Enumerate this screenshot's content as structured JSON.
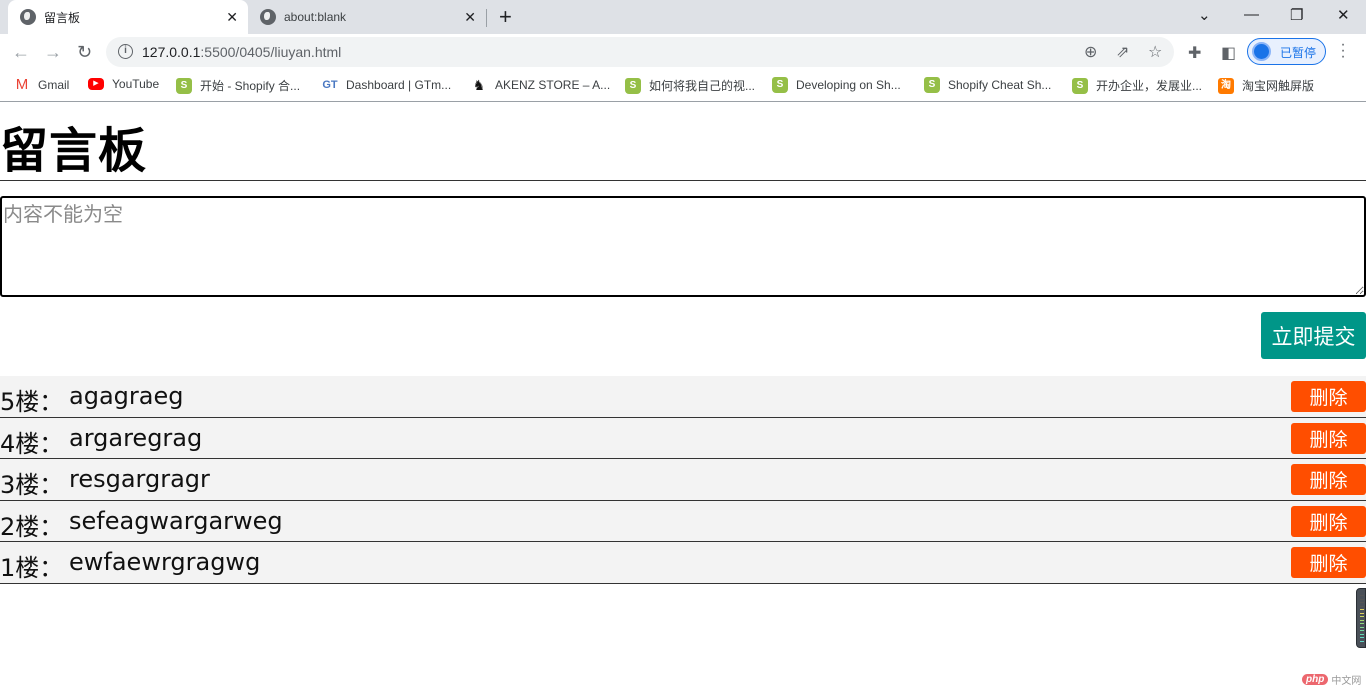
{
  "browser": {
    "tabs": [
      {
        "title": "留言板",
        "active": true
      },
      {
        "title": "about:blank",
        "active": false
      }
    ],
    "new_tab_icon": "plus-icon",
    "window_controls": [
      "chevron-down-icon",
      "minimize-icon",
      "restore-icon",
      "close-icon"
    ],
    "url_host": "127.0.0.1",
    "url_rest": ":5500/0405/liuyan.html",
    "profile_status": "已暂停",
    "bookmarks": [
      {
        "label": "Gmail",
        "icon": "gmail-icon"
      },
      {
        "label": "YouTube",
        "icon": "youtube-icon"
      },
      {
        "label": "开始 - Shopify 合...",
        "icon": "shopify-icon"
      },
      {
        "label": "Dashboard | GTm...",
        "icon": "gtmetrix-icon"
      },
      {
        "label": "AKENZ STORE – A...",
        "icon": "akenz-icon"
      },
      {
        "label": "如何将我自己的视...",
        "icon": "shopify-icon"
      },
      {
        "label": "Developing on Sh...",
        "icon": "shopify-icon"
      },
      {
        "label": "Shopify Cheat Sh...",
        "icon": "shopify-icon"
      },
      {
        "label": "开办企业，发展业...",
        "icon": "shopify-icon"
      },
      {
        "label": "淘宝网触屏版",
        "icon": "taobao-icon"
      }
    ]
  },
  "page": {
    "title": "留言板",
    "textarea_placeholder": "内容不能为空",
    "textarea_value": "",
    "submit_label": "立即提交",
    "delete_label": "删除",
    "messages": [
      {
        "floor": "5楼：",
        "content": "agagraeg"
      },
      {
        "floor": "4楼：",
        "content": "argaregrag"
      },
      {
        "floor": "3楼：",
        "content": "resgargragr"
      },
      {
        "floor": "2楼：",
        "content": "sefeagwargarweg"
      },
      {
        "floor": "1楼：",
        "content": "ewfaewrgragwg"
      }
    ],
    "colors": {
      "submit": "#009688",
      "delete": "#ff4e00",
      "row_bg": "#f3f3f3"
    }
  },
  "watermark": {
    "brand": "php",
    "text": "中文网"
  }
}
